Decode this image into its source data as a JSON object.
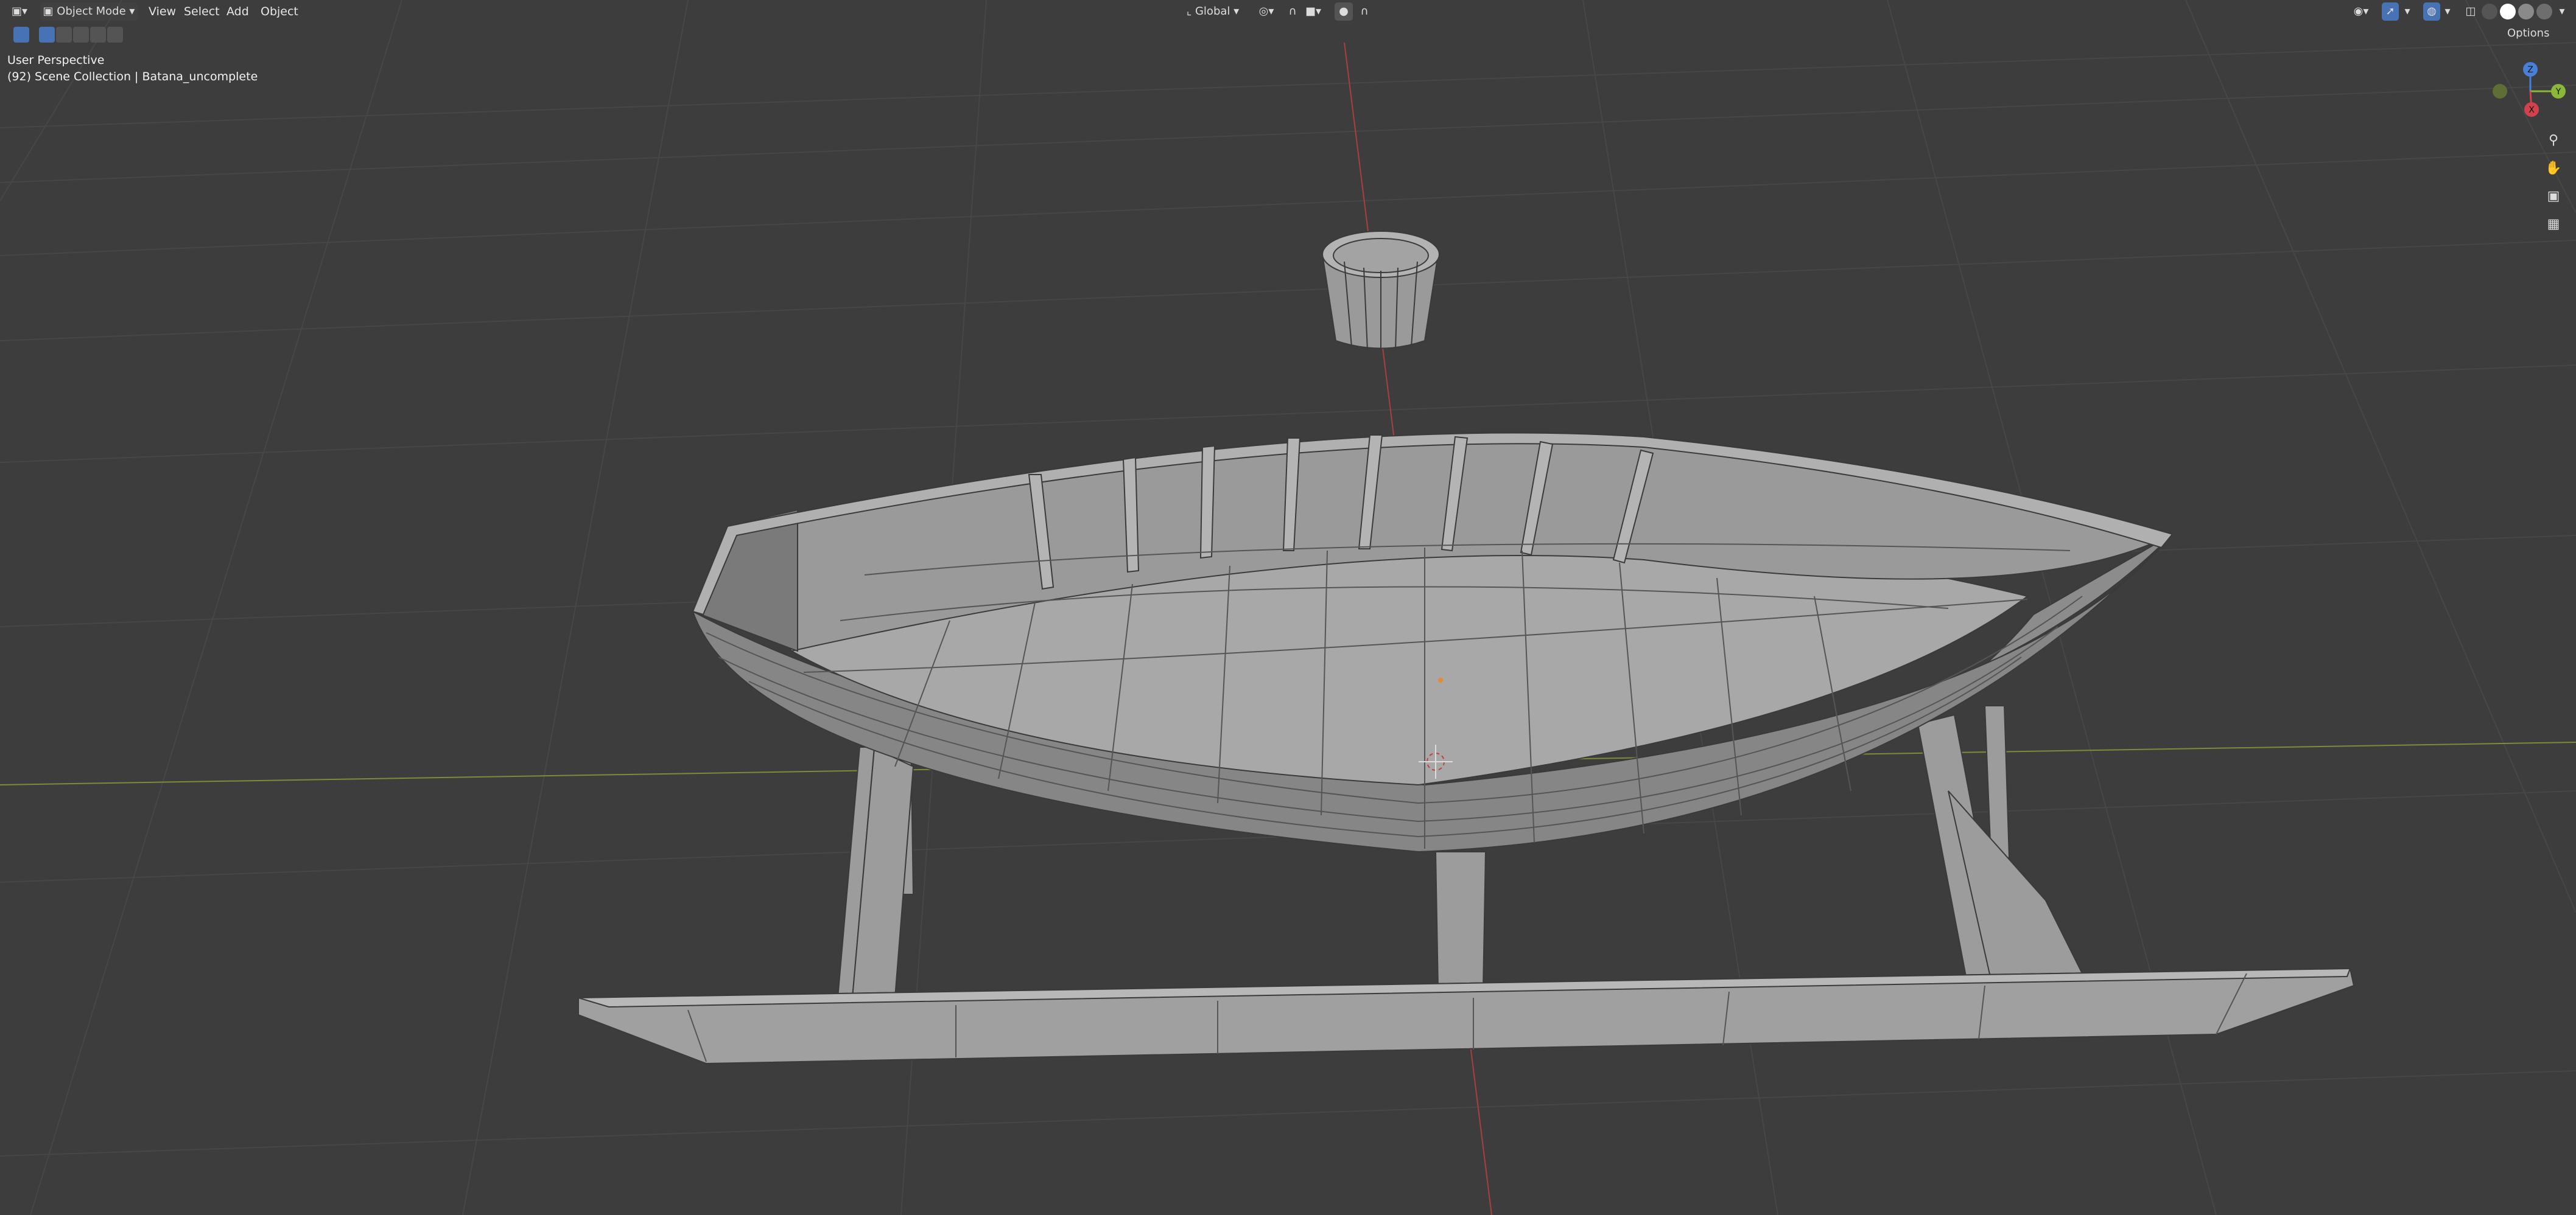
{
  "header": {
    "mode": "Object Mode",
    "menus": [
      "View",
      "Select",
      "Add",
      "Object"
    ],
    "orientation": "Global",
    "options_label": "Options"
  },
  "overlay_info": {
    "perspective": "User Perspective",
    "collection": "(92) Scene Collection | Batana_uncomplete"
  },
  "gizmo": {
    "z": "Z",
    "y": "Y",
    "x": "X"
  },
  "icons": {
    "editor_type": "3d-viewport-icon",
    "mode": "object-mode-icon",
    "orientation": "transform-orientation-icon",
    "pivot": "pivot-point-icon",
    "snap": "snap-magnet-icon",
    "proportional": "proportional-editing-icon",
    "zoom": "zoom-icon",
    "pan": "hand-pan-icon",
    "camera": "camera-view-icon",
    "ortho": "grid-ortho-icon"
  },
  "colors": {
    "viewport_bg": "#3d3d3d",
    "grid": "#4a4a4a",
    "axis_x": "#b5403f",
    "axis_y": "#8fa33a",
    "mesh_fill": "#9e9e9e",
    "mesh_edge": "#3a3a3a",
    "active_tool": "#4772b3"
  }
}
